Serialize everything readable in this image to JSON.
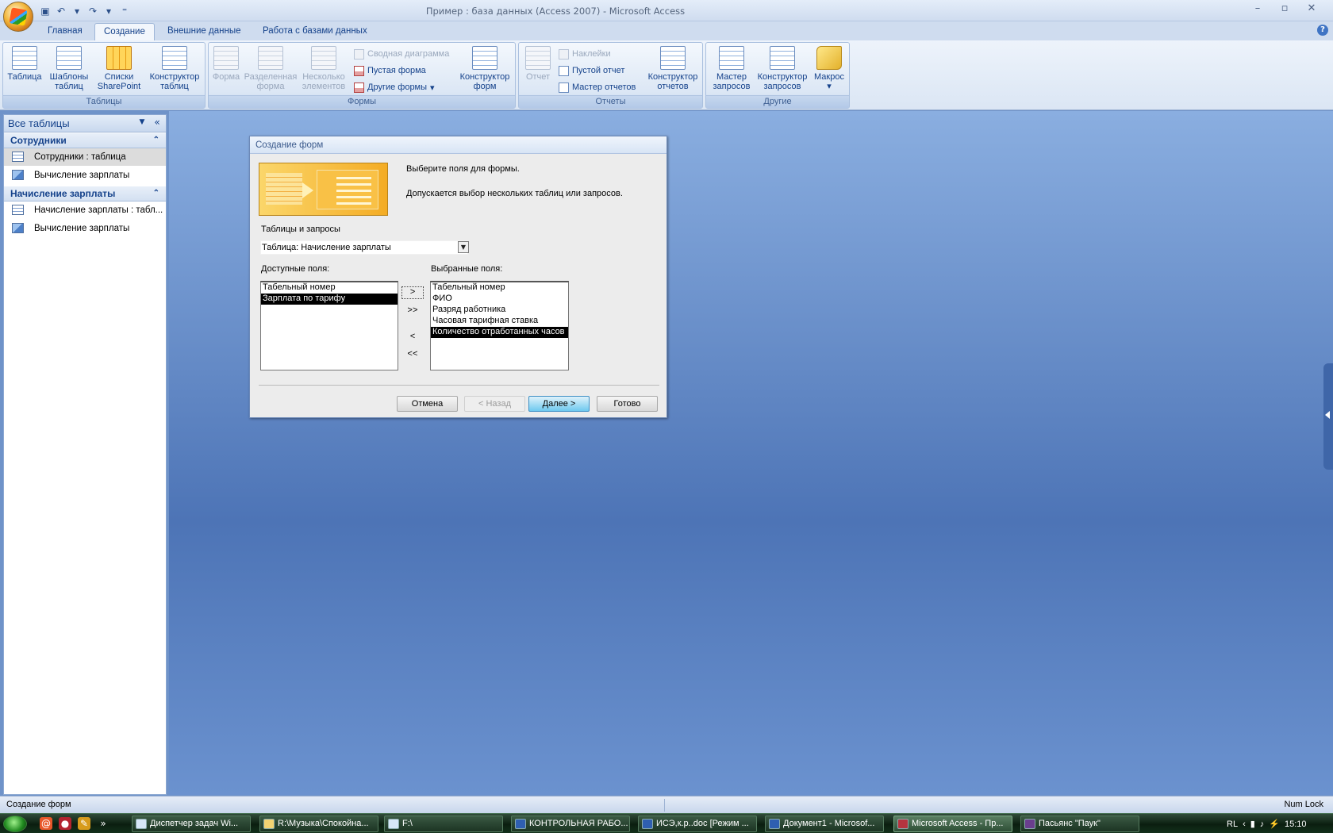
{
  "window": {
    "title": "Пример : база данных (Access 2007) - Microsoft Access",
    "controls": [
      "–",
      "▫",
      "✕"
    ]
  },
  "quick_access": [
    "save-icon",
    "undo-icon",
    "redo-icon",
    "customize-icon"
  ],
  "tabs": [
    "Главная",
    "Создание",
    "Внешние данные",
    "Работа с базами данных"
  ],
  "ribbon": {
    "tables": {
      "label": "Таблицы",
      "buttons": [
        "Таблица",
        "Шаблоны таблиц",
        "Списки SharePoint",
        "Конструктор таблиц"
      ]
    },
    "forms": {
      "label": "Формы",
      "form": "Форма",
      "split_form": "Разделенная форма",
      "multiple_items": "Несколько элементов",
      "pivot_chart": "Сводная диаграмма",
      "blank_form": "Пустая форма",
      "more_forms": "Другие формы",
      "form_design": "Конструктор форм"
    },
    "reports": {
      "label": "Отчеты",
      "report": "Отчет",
      "labels": "Наклейки",
      "blank_report": "Пустой отчет",
      "report_wizard": "Мастер отчетов",
      "report_design": "Конструктор отчетов"
    },
    "other": {
      "label": "Другие",
      "query_wizard": "Мастер запросов",
      "query_design": "Конструктор запросов",
      "macro": "Макрос"
    }
  },
  "nav": {
    "title": "Все таблицы",
    "groups": [
      {
        "name": "Сотрудники",
        "items": [
          "Сотрудники : таблица",
          "Вычисление зарплаты"
        ]
      },
      {
        "name": "Начисление зарплаты",
        "items": [
          "Начисление зарплаты : табл...",
          "Вычисление зарплаты"
        ]
      }
    ]
  },
  "dialog": {
    "title": "Создание форм",
    "heading": "Выберите поля для формы.",
    "subheading": "Допускается выбор нескольких таблиц или запросов.",
    "tables_label": "Таблицы и запросы",
    "table_selected": "Таблица: Начисление зарплаты",
    "available_label": "Доступные поля:",
    "selected_label": "Выбранные поля:",
    "available_fields": [
      "Табельный номер",
      "Зарплата по тарифу"
    ],
    "selected_fields": [
      "Табельный номер",
      "ФИО",
      "Разряд работника",
      "Часовая тарифная ставка",
      "Количество отработанных часов"
    ],
    "move_buttons": [
      ">",
      ">>",
      "<",
      "<<"
    ],
    "buttons": {
      "cancel": "Отмена",
      "back": "< Назад",
      "next": "Далее >",
      "finish": "Готово"
    }
  },
  "status": {
    "left": "Создание форм",
    "right": "Num Lock"
  },
  "taskbar": {
    "items": [
      "Диспетчер задач Wi...",
      "R:\\Музыка\\Спокойна...",
      "F:\\",
      "КОНТРОЛЬНАЯ РАБО...",
      "ИСЭ,к.р..doc [Режим ...",
      "Документ1 - Microsof...",
      "Microsoft Access - Пр...",
      "Пасьянс \"Паук\""
    ],
    "lang": "RL",
    "time": "15:10"
  },
  "colors": {
    "accent": "#15428b",
    "workspace": "#6f93c9",
    "taskbar": "#0b1e10"
  }
}
